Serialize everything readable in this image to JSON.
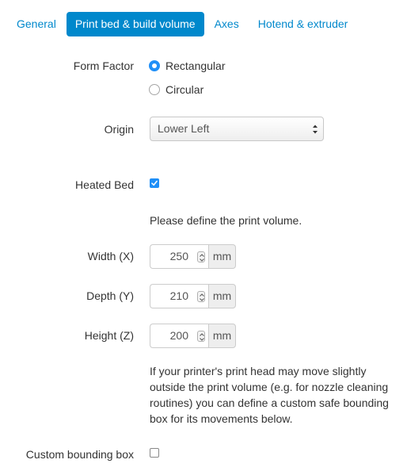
{
  "tabs": [
    {
      "label": "General",
      "active": false
    },
    {
      "label": "Print bed & build volume",
      "active": true
    },
    {
      "label": "Axes",
      "active": false
    },
    {
      "label": "Hotend & extruder",
      "active": false
    }
  ],
  "form_factor": {
    "label": "Form Factor",
    "options": [
      "Rectangular",
      "Circular"
    ],
    "selected": "Rectangular"
  },
  "origin": {
    "label": "Origin",
    "value": "Lower Left"
  },
  "heated_bed": {
    "label": "Heated Bed",
    "checked": true
  },
  "volume_hint": "Please define the print volume.",
  "dimensions": [
    {
      "label": "Width (X)",
      "value": "250",
      "unit": "mm"
    },
    {
      "label": "Depth (Y)",
      "value": "210",
      "unit": "mm"
    },
    {
      "label": "Height (Z)",
      "value": "200",
      "unit": "mm"
    }
  ],
  "bounding_help": [
    "If your printer's print head may move slightly",
    "outside the print volume (e.g. for nozzle cleaning",
    "routines) you can define a custom safe bounding",
    "box for its movements below."
  ],
  "custom_bounding_box": {
    "label": "Custom bounding box",
    "checked": false
  },
  "colors": {
    "accent": "#0088cc",
    "control": "#1f8ff7"
  }
}
